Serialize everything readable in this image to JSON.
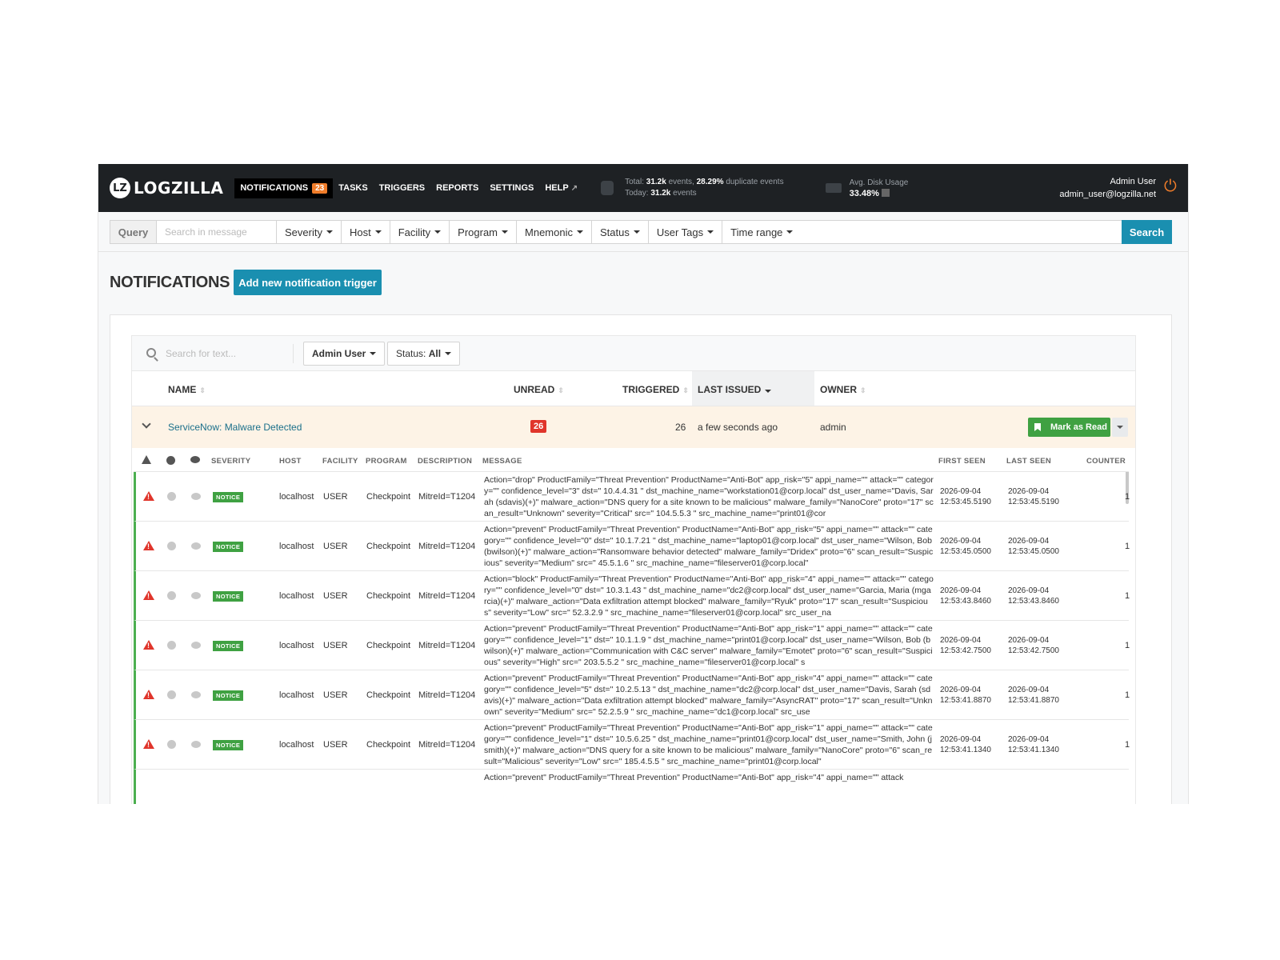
{
  "brand": {
    "badge": "LZ",
    "name": "LOGZILLA"
  },
  "nav": {
    "notifications": "NOTIFICATIONS",
    "notifications_count": "23",
    "tasks": "TASKS",
    "triggers": "TRIGGERS",
    "reports": "REPORTS",
    "settings": "SETTINGS",
    "help": "HELP"
  },
  "stats": {
    "total_label": "Total:",
    "total_value": "31.2k",
    "events_word": "events,",
    "dup_value": "28.29%",
    "dup_label": "duplicate events",
    "today_label": "Today:",
    "today_value": "31.2k",
    "today_events": "events",
    "disk_label": "Avg. Disk Usage",
    "disk_value": "33.48%"
  },
  "user": {
    "name": "Admin User",
    "email": "admin_user@logzilla.net"
  },
  "query": {
    "label": "Query",
    "placeholder": "Search in message",
    "filters": [
      "Severity",
      "Host",
      "Facility",
      "Program",
      "Mnemonic",
      "Status",
      "User Tags",
      "Time range"
    ],
    "search_button": "Search"
  },
  "page": {
    "title": "NOTIFICATIONS",
    "add_button": "Add new notification trigger"
  },
  "filterbar": {
    "placeholder": "Search for text...",
    "user_filter": "Admin User",
    "status_label": "Status:",
    "status_value": "All"
  },
  "table": {
    "headers": {
      "name": "NAME",
      "unread": "UNREAD",
      "triggered": "TRIGGERED",
      "last_issued": "LAST ISSUED",
      "owner": "OWNER"
    },
    "group": {
      "name": "ServiceNow: Malware Detected",
      "unread": "26",
      "triggered": "26",
      "last_issued": "a few seconds ago",
      "owner": "admin",
      "mark_button": "Mark as Read"
    }
  },
  "events": {
    "headers": {
      "severity": "SEVERITY",
      "host": "HOST",
      "facility": "FACILITY",
      "program": "PROGRAM",
      "description": "DESCRIPTION",
      "message": "MESSAGE",
      "first_seen": "FIRST SEEN",
      "last_seen": "LAST SEEN",
      "counter": "COUNTER"
    },
    "rows": [
      {
        "severity": "NOTICE",
        "host": "localhost",
        "facility": "USER",
        "program": "Checkpoint",
        "description": "MitreId=T1204",
        "message": "Action=\"drop\" ProductFamily=\"Threat Prevention\" ProductName=\"Anti-Bot\" app_risk=\"5\" appi_name=\"\" attack=\"\" category=\"\" confidence_level=\"3\" dst=\" 10.4.4.31 \" dst_machine_name=\"workstation01@corp.local\" dst_user_name=\"Davis, Sarah (sdavis)(+)\" malware_action=\"DNS query for a site known to be malicious\" malware_family=\"NanoCore\" proto=\"17\" scan_result=\"Unknown\" severity=\"Critical\" src=\" 104.5.5.3 \" src_machine_name=\"print01@cor",
        "first_date": "2026-09-04",
        "first_time": "12:53:45.5190",
        "last_date": "2026-09-04",
        "last_time": "12:53:45.5190",
        "counter": "1"
      },
      {
        "severity": "NOTICE",
        "host": "localhost",
        "facility": "USER",
        "program": "Checkpoint",
        "description": "MitreId=T1204",
        "message": "Action=\"prevent\" ProductFamily=\"Threat Prevention\" ProductName=\"Anti-Bot\" app_risk=\"5\" appi_name=\"\" attack=\"\" category=\"\" confidence_level=\"0\" dst=\" 10.1.7.21 \" dst_machine_name=\"laptop01@corp.local\" dst_user_name=\"Wilson, Bob (bwilson)(+)\" malware_action=\"Ransomware behavior detected\" malware_family=\"Dridex\" proto=\"6\" scan_result=\"Suspicious\" severity=\"Medium\" src=\" 45.5.1.6 \" src_machine_name=\"fileserver01@corp.local\"",
        "first_date": "2026-09-04",
        "first_time": "12:53:45.0500",
        "last_date": "2026-09-04",
        "last_time": "12:53:45.0500",
        "counter": "1"
      },
      {
        "severity": "NOTICE",
        "host": "localhost",
        "facility": "USER",
        "program": "Checkpoint",
        "description": "MitreId=T1204",
        "message": "Action=\"block\" ProductFamily=\"Threat Prevention\" ProductName=\"Anti-Bot\" app_risk=\"4\" appi_name=\"\" attack=\"\" category=\"\" confidence_level=\"0\" dst=\" 10.3.1.43 \" dst_machine_name=\"dc2@corp.local\" dst_user_name=\"Garcia, Maria (mgarcia)(+)\" malware_action=\"Data exfiltration attempt blocked\" malware_family=\"Ryuk\" proto=\"17\" scan_result=\"Suspicious\" severity=\"Low\" src=\" 52.3.2.9 \" src_machine_name=\"fileserver01@corp.local\" src_user_na",
        "first_date": "2026-09-04",
        "first_time": "12:53:43.8460",
        "last_date": "2026-09-04",
        "last_time": "12:53:43.8460",
        "counter": "1"
      },
      {
        "severity": "NOTICE",
        "host": "localhost",
        "facility": "USER",
        "program": "Checkpoint",
        "description": "MitreId=T1204",
        "message": "Action=\"prevent\" ProductFamily=\"Threat Prevention\" ProductName=\"Anti-Bot\" app_risk=\"1\" appi_name=\"\" attack=\"\" category=\"\" confidence_level=\"1\" dst=\" 10.1.1.9 \" dst_machine_name=\"print01@corp.local\" dst_user_name=\"Wilson, Bob (bwilson)(+)\" malware_action=\"Communication with C&C server\" malware_family=\"Emotet\" proto=\"6\" scan_result=\"Suspicious\" severity=\"High\" src=\" 203.5.5.2 \" src_machine_name=\"fileserver01@corp.local\" s",
        "first_date": "2026-09-04",
        "first_time": "12:53:42.7500",
        "last_date": "2026-09-04",
        "last_time": "12:53:42.7500",
        "counter": "1"
      },
      {
        "severity": "NOTICE",
        "host": "localhost",
        "facility": "USER",
        "program": "Checkpoint",
        "description": "MitreId=T1204",
        "message": "Action=\"prevent\" ProductFamily=\"Threat Prevention\" ProductName=\"Anti-Bot\" app_risk=\"4\" appi_name=\"\" attack=\"\" category=\"\" confidence_level=\"5\" dst=\" 10.2.5.13 \" dst_machine_name=\"dc2@corp.local\" dst_user_name=\"Davis, Sarah (sdavis)(+)\" malware_action=\"Data exfiltration attempt blocked\" malware_family=\"AsyncRAT\" proto=\"17\" scan_result=\"Unknown\" severity=\"Medium\" src=\" 52.2.5.9 \" src_machine_name=\"dc1@corp.local\" src_use",
        "first_date": "2026-09-04",
        "first_time": "12:53:41.8870",
        "last_date": "2026-09-04",
        "last_time": "12:53:41.8870",
        "counter": "1"
      },
      {
        "severity": "NOTICE",
        "host": "localhost",
        "facility": "USER",
        "program": "Checkpoint",
        "description": "MitreId=T1204",
        "message": "Action=\"prevent\" ProductFamily=\"Threat Prevention\" ProductName=\"Anti-Bot\" app_risk=\"1\" appi_name=\"\" attack=\"\" category=\"\" confidence_level=\"1\" dst=\" 10.5.6.25 \" dst_machine_name=\"print01@corp.local\" dst_user_name=\"Smith, John (jsmith)(+)\" malware_action=\"DNS query for a site known to be malicious\" malware_family=\"NanoCore\" proto=\"6\" scan_result=\"Malicious\" severity=\"Low\" src=\" 185.4.5.5 \" src_machine_name=\"print01@corp.local\"",
        "first_date": "2026-09-04",
        "first_time": "12:53:41.1340",
        "last_date": "2026-09-04",
        "last_time": "12:53:41.1340",
        "counter": "1"
      }
    ],
    "partial_message": "Action=\"prevent\" ProductFamily=\"Threat Prevention\" ProductName=\"Anti-Bot\" app_risk=\"4\" appi_name=\"\" attack"
  },
  "colors": {
    "accent": "#1a8fb0",
    "orange": "#f07d2a",
    "danger": "#e0352b",
    "success": "#3fa142",
    "group_bg": "#fdf3e6"
  }
}
